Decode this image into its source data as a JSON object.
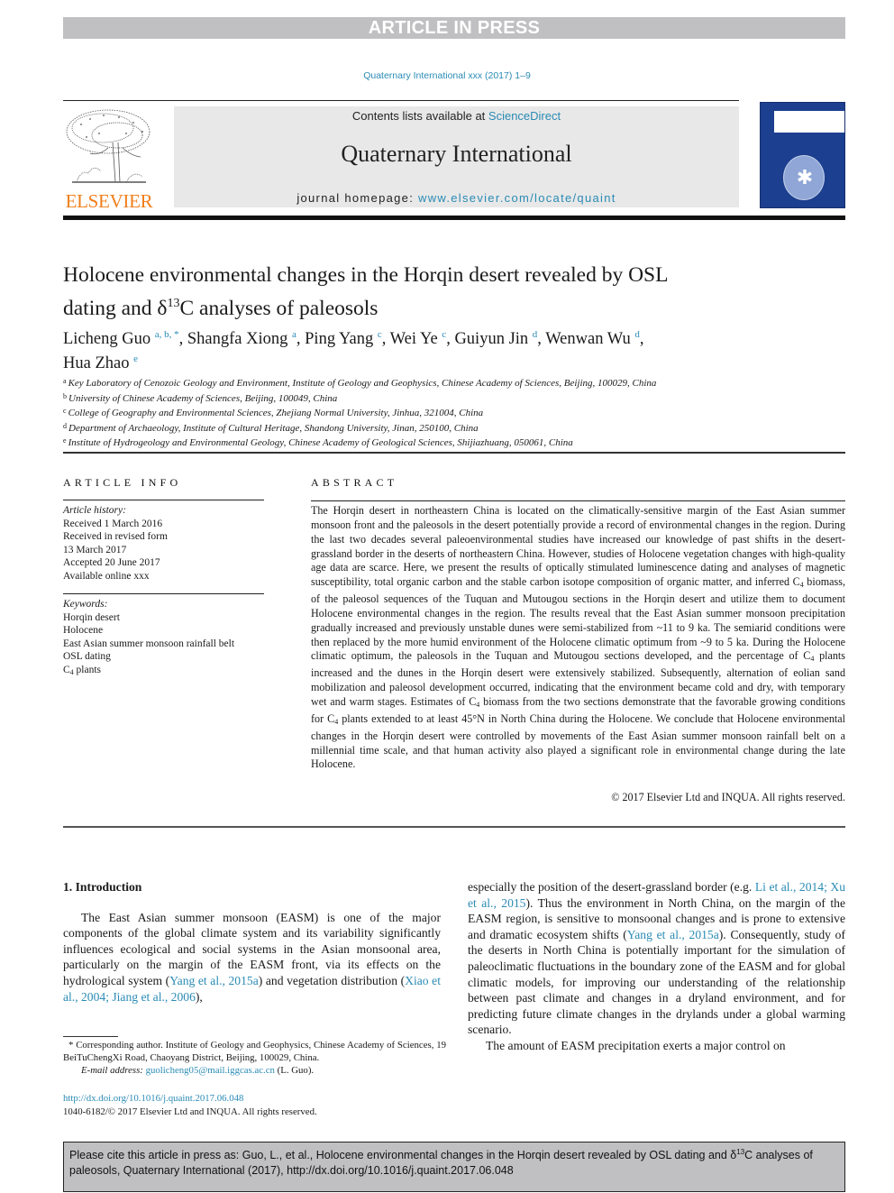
{
  "banner": {
    "label": "ARTICLE IN PRESS"
  },
  "journal_ref": "Quaternary International xxx (2017) 1–9",
  "publisher": {
    "logo_text": "ELSEVIER",
    "logo_color": "#f07e1b"
  },
  "masthead": {
    "contents_prefix": "Contents lists available at ",
    "contents_link": "ScienceDirect",
    "journal_name": "Quaternary International",
    "homepage_prefix": "journal homepage: ",
    "homepage_link": "www.elsevier.com/locate/quaint"
  },
  "cover": {
    "description": "Quaternary International journal cover",
    "color": "#1c3f8f"
  },
  "article": {
    "title_line1": "Holocene environmental changes in the Horqin desert revealed by OSL",
    "title_line2_pre": "dating and δ",
    "title_sup": "13",
    "title_line2_post": "C analyses of paleosols",
    "authors": [
      {
        "name": "Licheng Guo",
        "marks": "a, b, *",
        "sep": ", "
      },
      {
        "name": "Shangfa Xiong",
        "marks": "a",
        "sep": ", "
      },
      {
        "name": "Ping Yang",
        "marks": "c",
        "sep": ", "
      },
      {
        "name": "Wei Ye",
        "marks": "c",
        "sep": ", "
      },
      {
        "name": "Guiyun Jin",
        "marks": "d",
        "sep": ", "
      },
      {
        "name": "Wenwan Wu",
        "marks": "d",
        "sep": ","
      },
      {
        "name": "Hua Zhao",
        "marks": "e",
        "sep": ""
      }
    ],
    "affiliations": [
      {
        "key": "a",
        "text": "Key Laboratory of Cenozoic Geology and Environment, Institute of Geology and Geophysics, Chinese Academy of Sciences, Beijing, 100029, China"
      },
      {
        "key": "b",
        "text": "University of Chinese Academy of Sciences, Beijing, 100049, China"
      },
      {
        "key": "c",
        "text": "College of Geography and Environmental Sciences, Zhejiang Normal University, Jinhua, 321004, China"
      },
      {
        "key": "d",
        "text": "Department of Archaeology, Institute of Cultural Heritage, Shandong University, Jinan, 250100, China"
      },
      {
        "key": "e",
        "text": "Institute of Hydrogeology and Environmental Geology, Chinese Academy of Geological Sciences, Shijiazhuang, 050061, China"
      }
    ]
  },
  "article_info": {
    "heading": "ARTICLE INFO",
    "history_label": "Article history:",
    "history": [
      "Received 1 March 2016",
      "Received in revised form",
      "13 March 2017",
      "Accepted 20 June 2017",
      "Available online xxx"
    ],
    "keywords_label": "Keywords:",
    "keywords": [
      "Horqin desert",
      "Holocene",
      "East Asian summer monsoon rainfall belt",
      "OSL dating"
    ],
    "keyword_c4_base": "C",
    "keyword_c4_sub": "4",
    "keyword_c4_rest": " plants"
  },
  "abstract": {
    "heading": "ABSTRACT",
    "p1": "The Horqin desert in northeastern China is located on the climatically-sensitive margin of the East Asian summer monsoon front and the paleosols in the desert potentially provide a record of environmental changes in the region. During the last two decades several paleoenvironmental studies have increased our knowledge of past shifts in the desert-grassland border in the deserts of northeastern China. However, studies of Holocene vegetation changes with high-quality age data are scarce. Here, we present the results of optically stimulated luminescence dating and analyses of magnetic susceptibility, total organic carbon and the stable carbon isotope composition of organic matter, and inferred C",
    "p2": " biomass, of the paleosol sequences of the Tuquan and Mutougou sections in the Horqin desert and utilize them to document Holocene environmental changes in the region. The results reveal that the East Asian summer monsoon precipitation gradually increased and previously unstable dunes were semi-stabilized from ~11 to 9 ka. The semiarid conditions were then replaced by the more humid environment of the Holocene climatic optimum from ~9 to 5 ka. During the Holocene climatic optimum, the paleosols in the Tuquan and Mutougou sections developed, and the percentage of C",
    "p3": " plants increased and the dunes in the Horqin desert were extensively stabilized. Subsequently, alternation of eolian sand mobilization and paleosol development occurred, indicating that the environment became cold and dry, with temporary wet and warm stages. Estimates of C",
    "p4": " biomass from the two sections demonstrate that the favorable growing conditions for C",
    "p5": " plants extended to at least 45°N in North China during the Holocene. We conclude that Holocene environmental changes in the Horqin desert were controlled by movements of the East Asian summer monsoon rainfall belt on a millennial time scale, and that human activity also played a significant role in environmental change during the late Holocene.",
    "sub": "4",
    "copyright": "© 2017 Elsevier Ltd and INQUA. All rights reserved."
  },
  "introduction": {
    "heading": "1.  Introduction",
    "left_p1_a": "The East Asian summer monsoon (EASM) is one of the major components of the global climate system and its variability significantly influences ecological and social systems in the Asian monsoonal area, particularly on the margin of the EASM front, via its effects on the hydrological system (",
    "cite1": "Yang et al., 2015a",
    "left_p1_b": ") and vegetation distribution (",
    "cite2": "Xiao et al., 2004; Jiang et al., 2006",
    "left_p1_c": "),",
    "right_p1_a": "especially the position of the desert-grassland border (e.g. ",
    "cite3": "Li et al., 2014; Xu et al., 2015",
    "right_p1_b": "). Thus the environment in North China, on the margin of the EASM region, is sensitive to monsoonal changes and is prone to extensive and dramatic ecosystem shifts (",
    "cite4": "Yang et al., 2015a",
    "right_p1_c": "). Consequently, study of the deserts in North China is potentially important for the simulation of paleoclimatic fluctuations in the boundary zone of the EASM and for global climatic models, for improving our understanding of the relationship between past climate and changes in a dryland environment, and for predicting future climate changes in the drylands under a global warming scenario.",
    "right_p2": "The amount of EASM precipitation exerts a major control on"
  },
  "footnote": {
    "star_text": "* Corresponding author. Institute of Geology and Geophysics, Chinese Academy of Sciences, 19 BeiTuChengXi Road, Chaoyang District, Beijing, 100029, China.",
    "email_label": "E-mail address: ",
    "email": "guolicheng05@mail.iggcas.ac.cn",
    "email_suffix": " (L. Guo).",
    "doi": "http://dx.doi.org/10.1016/j.quaint.2017.06.048",
    "issn_line": "1040-6182/© 2017 Elsevier Ltd and INQUA. All rights reserved."
  },
  "cite_box": {
    "pre": "Please cite this article in press as: Guo, L., et al., Holocene environmental changes in the Horqin desert revealed by OSL dating and δ",
    "sup": "13",
    "post": "C analyses of paleosols, Quaternary International (2017), http://dx.doi.org/10.1016/j.quaint.2017.06.048"
  }
}
